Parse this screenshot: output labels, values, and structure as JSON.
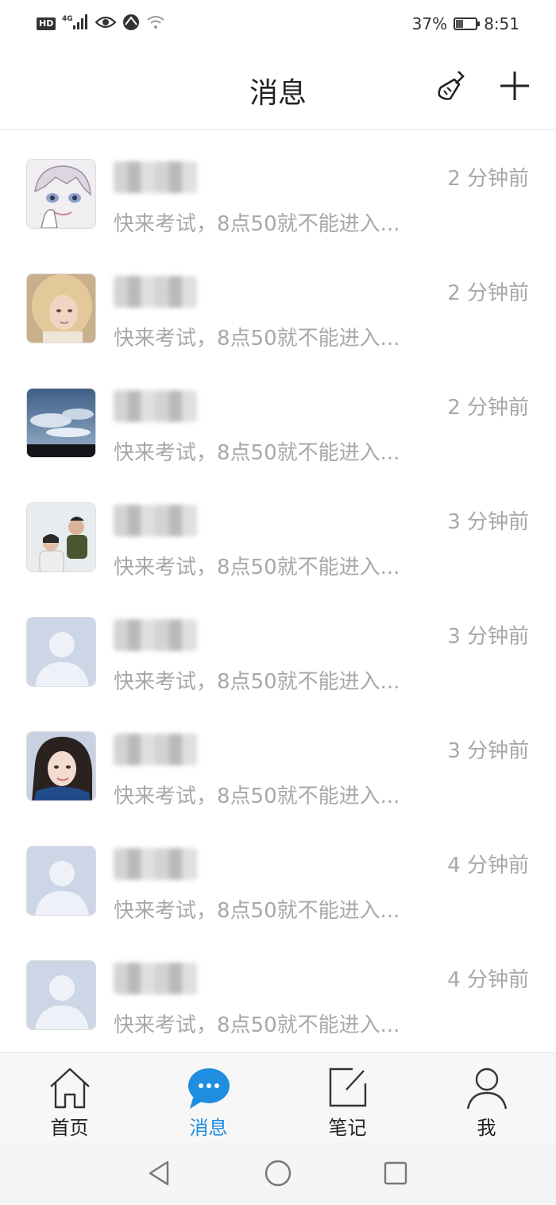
{
  "status_bar": {
    "badge": "HD",
    "signal": "4G",
    "battery_percent": "37%",
    "battery_level": 0.37,
    "time": "8:51",
    "icons": [
      "hd-icon",
      "signal-icon",
      "eye-icon",
      "vpn-icon",
      "wifi-icon",
      "battery-icon"
    ]
  },
  "header": {
    "title": "消息",
    "clean_icon": "broom-icon",
    "add_icon": "plus-icon"
  },
  "messages": [
    {
      "time": "2 分钟前",
      "preview": "快来考试，8点50就不能进入...",
      "avatar": "anime"
    },
    {
      "time": "2 分钟前",
      "preview": "快来考试，8点50就不能进入...",
      "avatar": "photo-blonde"
    },
    {
      "time": "2 分钟前",
      "preview": "快来考试，8点50就不能进入...",
      "avatar": "photo-sky"
    },
    {
      "time": "3 分钟前",
      "preview": "快来考试，8点50就不能进入...",
      "avatar": "photo-snow"
    },
    {
      "time": "3 分钟前",
      "preview": "快来考试，8点50就不能进入...",
      "avatar": "default"
    },
    {
      "time": "3 分钟前",
      "preview": "快来考试，8点50就不能进入...",
      "avatar": "photo-girl"
    },
    {
      "time": "4 分钟前",
      "preview": "快来考试，8点50就不能进入...",
      "avatar": "default"
    },
    {
      "time": "4 分钟前",
      "preview": "快来考试，8点50就不能进入...",
      "avatar": "default"
    }
  ],
  "tabs": [
    {
      "label": "首页",
      "icon": "home-icon",
      "active": false
    },
    {
      "label": "消息",
      "icon": "chat-bubble-icon",
      "active": true
    },
    {
      "label": "笔记",
      "icon": "edit-note-icon",
      "active": false
    },
    {
      "label": "我",
      "icon": "person-icon",
      "active": false
    }
  ],
  "colors": {
    "accent": "#1f8ee0",
    "muted_text": "#a8a8a8",
    "default_avatar": "#cdd6e6"
  }
}
